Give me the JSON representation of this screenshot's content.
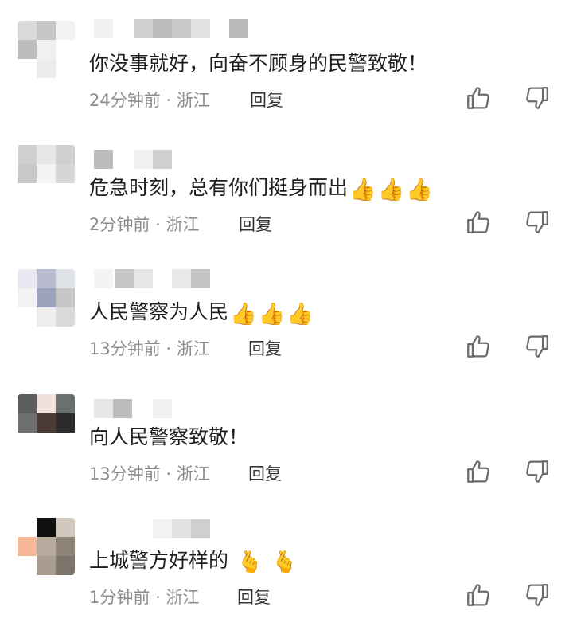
{
  "comments": [
    {
      "text": "你没事就好，向奋不顾身的民警致敬！",
      "emojis": [],
      "time": "24分钟前",
      "location": "浙江",
      "reply": "回复"
    },
    {
      "text": "危急时刻，总有你们挺身而出",
      "emojis": [
        "👍",
        "👍",
        "👍"
      ],
      "time": "2分钟前",
      "location": "浙江",
      "reply": "回复"
    },
    {
      "text": "人民警察为人民",
      "emojis": [
        "👍",
        "👍",
        "👍"
      ],
      "time": "13分钟前",
      "location": "浙江",
      "reply": "回复"
    },
    {
      "text": "向人民警察致敬！",
      "emojis": [],
      "time": "13分钟前",
      "location": "浙江",
      "reply": "回复"
    },
    {
      "text": "上城警方好样的",
      "emojis": [
        "🫰",
        "🫰"
      ],
      "time": "1分钟前",
      "location": "浙江",
      "reply": "回复"
    }
  ],
  "meta_separator": "·",
  "icons": {
    "like": "thumbs-up-icon",
    "dislike": "thumbs-down-icon"
  },
  "colors": {
    "meta_text": "#8c8c8c",
    "icon_stroke": "#6b6b6b"
  }
}
